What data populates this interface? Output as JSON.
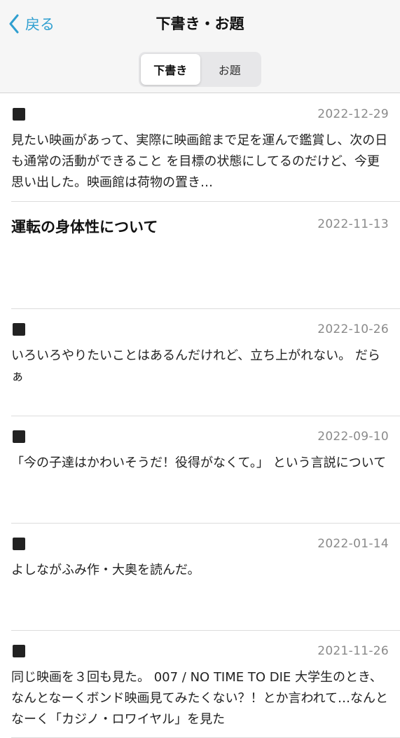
{
  "header": {
    "back_label": "戻る",
    "title": "下書き・お題",
    "segments": [
      "下書き",
      "お題"
    ],
    "active_segment": "下書き"
  },
  "colors": {
    "accent": "#2f9fd0",
    "date": "#8a8a8a"
  },
  "entries": [
    {
      "date": "2022-12-29",
      "body": "見たい映画があって、実際に映画館まで足を運んで鑑賞し、次の日も通常の活動ができること を目標の状態にしてるのだけど、今更思い出した。映画館は荷物の置き…"
    },
    {
      "date": "2022-11-13",
      "title": "運転の身体性について"
    },
    {
      "date": "2022-10-26",
      "body": "いろいろやりたいことはあるんだけれど、立ち上がれない。 だらぁ"
    },
    {
      "date": "2022-09-10",
      "body": "「今の子達はかわいそうだ！役得がなくて。」 という言説について"
    },
    {
      "date": "2022-01-14",
      "body": "よしながふみ作・大奥を読んだ。"
    },
    {
      "date": "2021-11-26",
      "body": "同じ映画を３回も見た。 007 / NO TIME TO DIE 大学生のとき、なんとなーくボンド映画見てみたくない？！とか言われて…なんとなーく「カジノ・ロワイヤル」を見た"
    }
  ]
}
